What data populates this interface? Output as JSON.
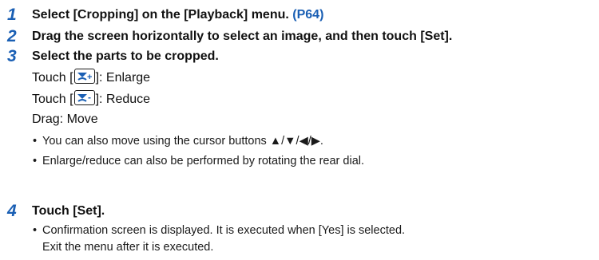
{
  "steps": [
    {
      "number": "1",
      "title": "Select [Cropping] on the [Playback] menu.",
      "page_ref": "(P64)"
    },
    {
      "number": "2",
      "title": "Drag the screen horizontally to select an image, and then touch [Set]."
    },
    {
      "number": "3",
      "title": "Select the parts to be cropped.",
      "enlarge_prefix": "Touch [",
      "enlarge_suffix": "]: Enlarge",
      "reduce_prefix": "Touch [",
      "reduce_suffix": "]: Reduce",
      "drag_text": "Drag: Move",
      "bullets": [
        "You can also move using the cursor buttons ▲/▼/◀/▶.",
        "Enlarge/reduce can also be performed by rotating the rear dial."
      ]
    },
    {
      "number": "4",
      "title": "Touch [Set].",
      "bullet_line1": "Confirmation screen is displayed. It is executed when [Yes] is selected.",
      "bullet_line2": "Exit the menu after it is executed."
    }
  ],
  "bullet_symbol": "•",
  "icons": {
    "enlarge": "zoom-in-icon",
    "reduce": "zoom-out-icon"
  },
  "colors": {
    "accent": "#1a5fb4",
    "text": "#111111"
  }
}
